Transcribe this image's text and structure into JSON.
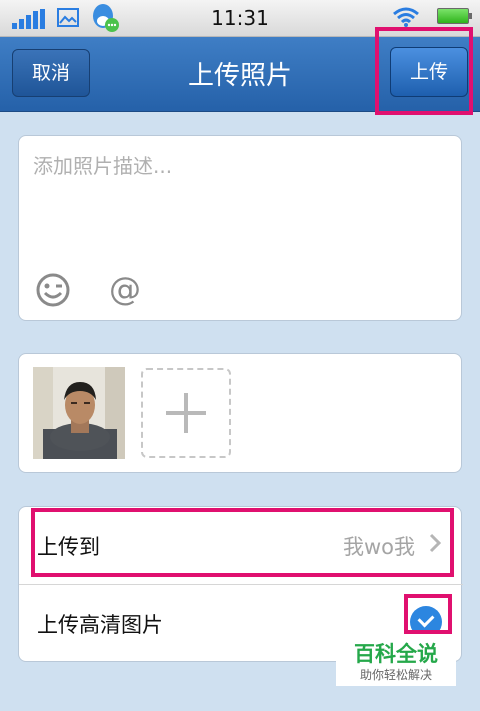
{
  "status_bar": {
    "time": "11:31"
  },
  "nav": {
    "cancel_label": "取消",
    "title": "上传照片",
    "upload_label": "上传"
  },
  "description": {
    "placeholder": "添加照片描述..."
  },
  "settings": {
    "upload_to_label": "上传到",
    "upload_to_value": "我wo我",
    "hd_label": "上传高清图片",
    "hd_enabled": true
  },
  "watermark": {
    "title": "百科全说",
    "subtitle": "助你轻松解决"
  },
  "colors": {
    "nav": "#2f6db5",
    "highlight": "#e0106f",
    "accent": "#2c86e0"
  }
}
